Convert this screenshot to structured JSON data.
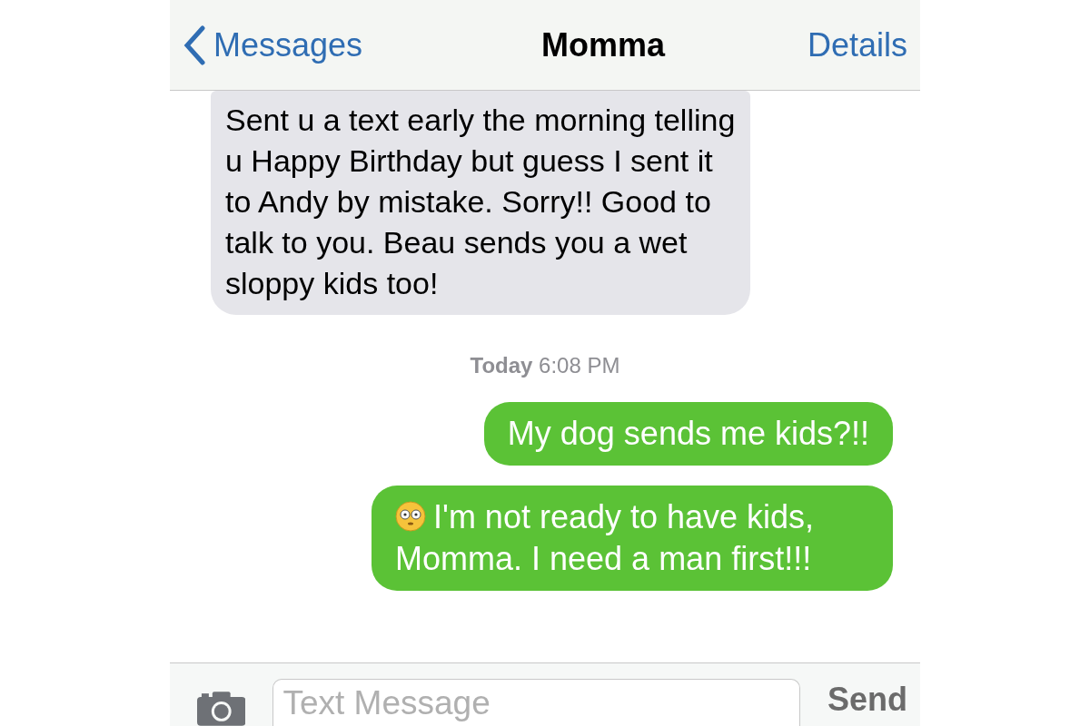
{
  "nav_bar": {
    "back_label": "Messages",
    "title": "Momma",
    "action": "Details"
  },
  "messages": [
    {
      "kind": "incoming",
      "text": "Sent u a text early the morning telling u Happy Birthday but guess I sent it to Andy by mistake. Sorry!!  Good to talk to you. Beau sends you a wet sloppy kids too!"
    },
    {
      "kind": "timestamp",
      "text": "**Today** 6:08 PM"
    },
    {
      "kind": "outgoing",
      "text": "My dog sends me kids?!!",
      "emoji": false
    },
    {
      "kind": "outgoing",
      "text": "I'm not ready to have kids, Momma. I need a man first!!!",
      "emoji": true
    }
  ],
  "compose": {
    "placeholder": "Text Message",
    "send_label": "Send"
  }
}
